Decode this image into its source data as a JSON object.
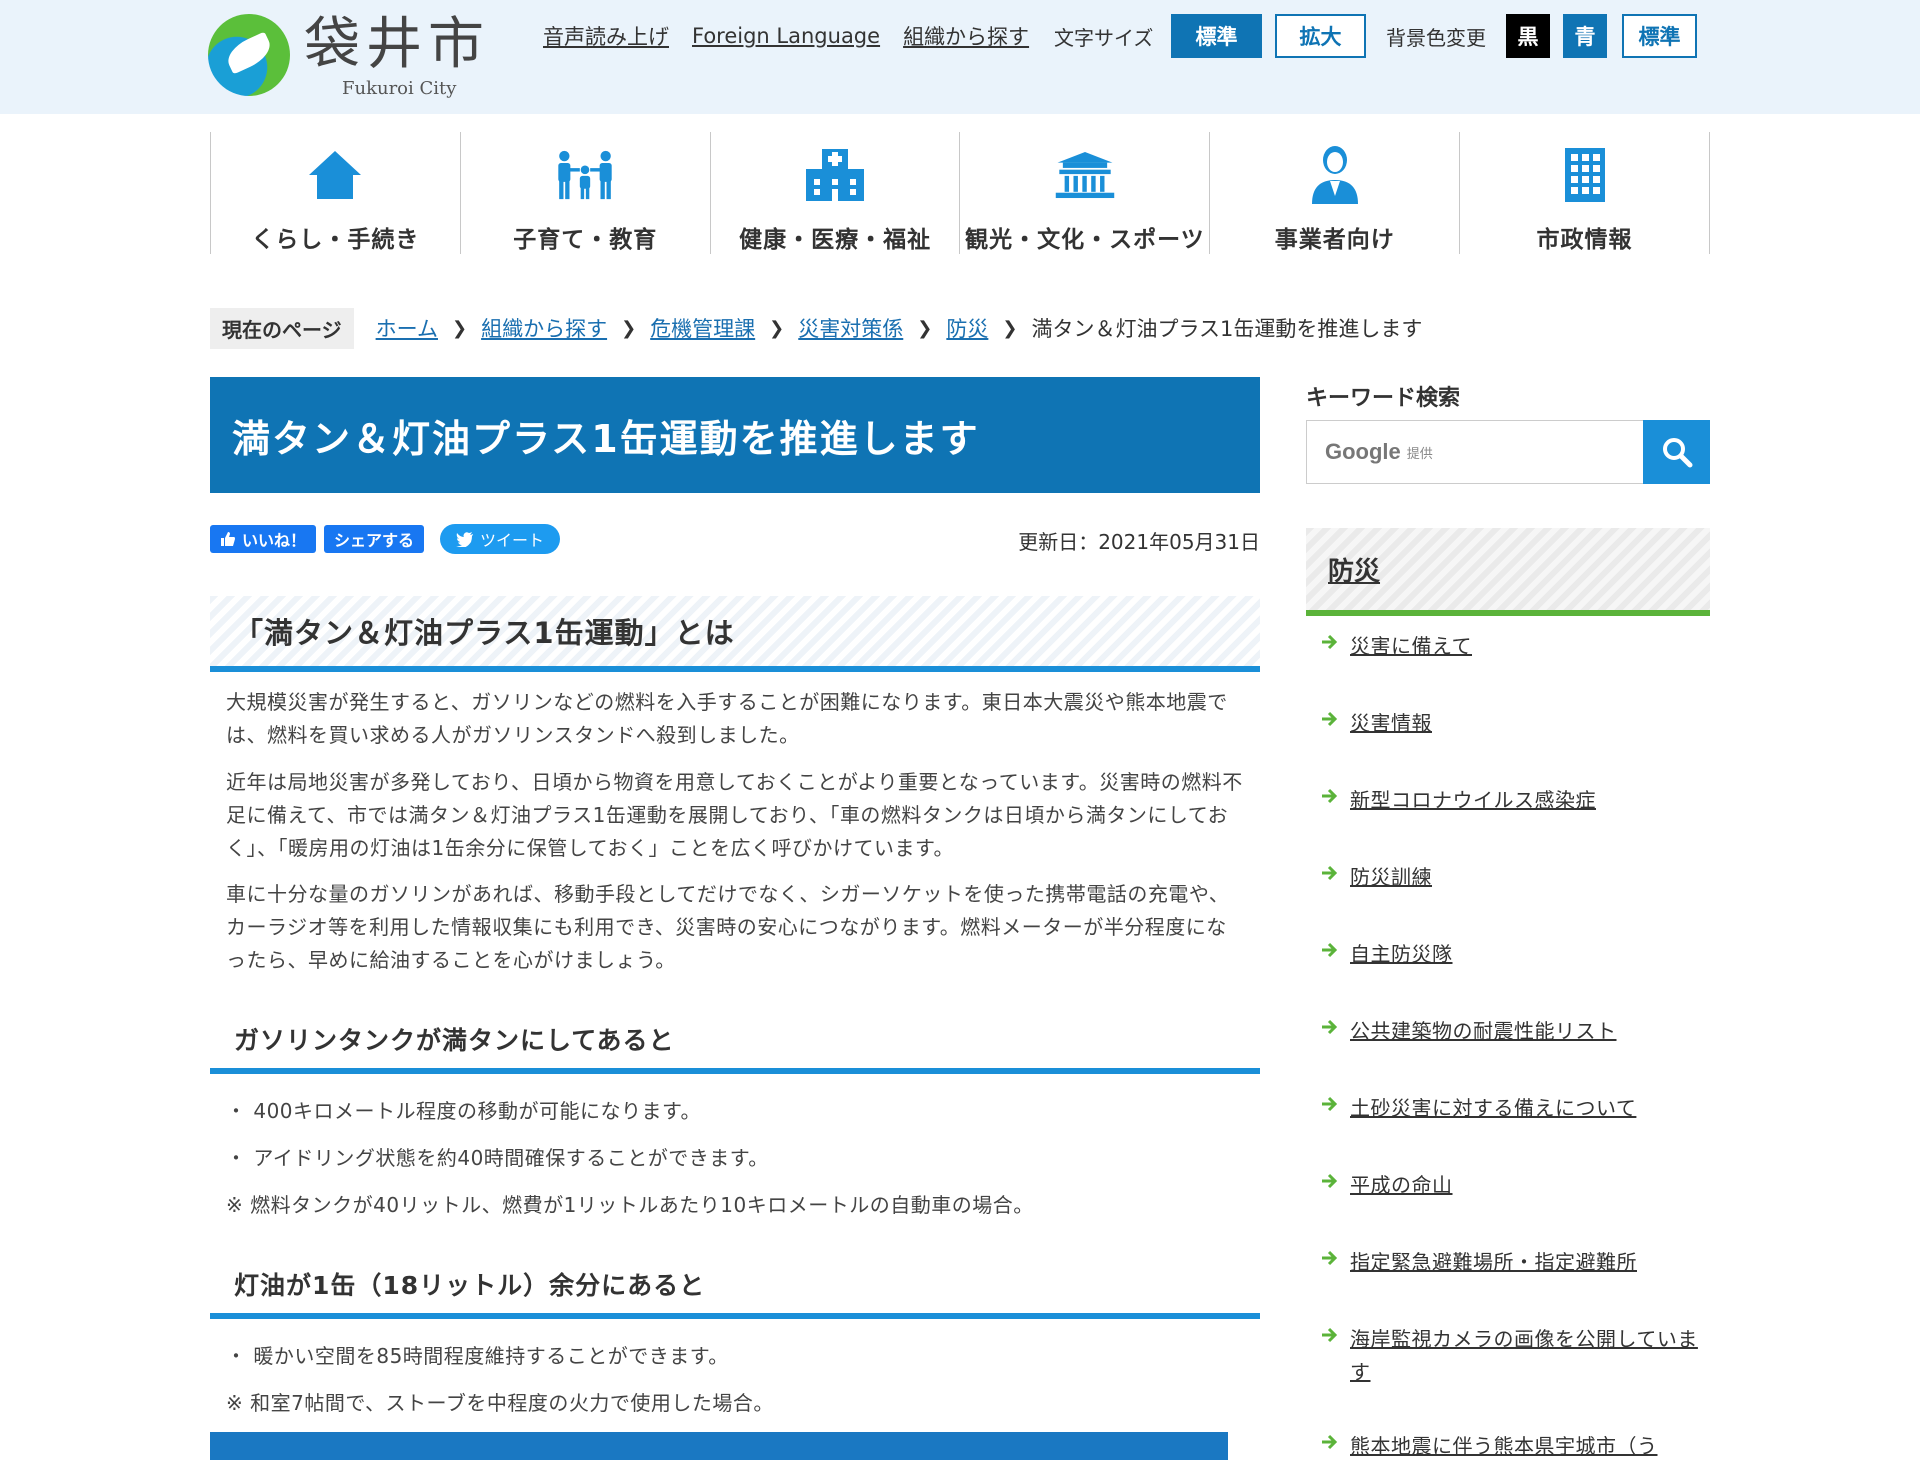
{
  "header": {
    "logo_title": "袋井市",
    "logo_sub": "Fukuroi City",
    "util_links": [
      "音声読み上げ",
      "Foreign Language",
      "組織から探す"
    ],
    "font_size_label": "文字サイズ",
    "font_size_standard": "標準",
    "font_size_large": "拡大",
    "bg_color_label": "背景色変更",
    "bg_black": "黒",
    "bg_blue": "青",
    "bg_standard": "標準"
  },
  "nav": [
    {
      "label": "くらし・手続き",
      "icon": "home-icon"
    },
    {
      "label": "子育て・教育",
      "icon": "family-icon"
    },
    {
      "label": "健康・医療・福祉",
      "icon": "hospital-icon"
    },
    {
      "label": "観光・文化・スポーツ",
      "icon": "temple-icon"
    },
    {
      "label": "事業者向け",
      "icon": "businessperson-icon"
    },
    {
      "label": "市政情報",
      "icon": "building-icon"
    }
  ],
  "breadcrumb": {
    "here_label": "現在のページ",
    "links": [
      "ホーム",
      "組織から探す",
      "危機管理課",
      "災害対策係",
      "防災"
    ],
    "current": "満タン＆灯油プラス1缶運動を推進します"
  },
  "main": {
    "title": "満タン＆灯油プラス1缶運動を推進します",
    "social": {
      "like": "いいね！",
      "share": "シェアする",
      "tweet": "ツイート"
    },
    "updated": "更新日：2021年05月31日",
    "section1_heading": "「満タン＆灯油プラス1缶運動」とは",
    "paragraphs": [
      "大規模災害が発生すると、ガソリンなどの燃料を入手することが困難になります。東日本大震災や熊本地震では、燃料を買い求める人がガソリンスタンドへ殺到しました。",
      "近年は局地災害が多発しており、日頃から物資を用意しておくことがより重要となっています。災害時の燃料不足に備えて、市では満タン＆灯油プラス1缶運動を展開しており、「車の燃料タンクは日頃から満タンにしておく」、「暖房用の灯油は1缶余分に保管しておく」ことを広く呼びかけています。",
      "車に十分な量のガソリンがあれば、移動手段としてだけでなく、シガーソケットを使った携帯電話の充電や、カーラジオ等を利用した情報収集にも利用でき、災害時の安心につながります。燃料メーターが半分程度になったら、早めに給油することを心がけましょう。"
    ],
    "section2_heading": "ガソリンタンクが満タンにしてあると",
    "section2_items": [
      "・ 400キロメートル程度の移動が可能になります。",
      "・ アイドリング状態を約40時間確保することができます。",
      "※ 燃料タンクが40リットル、燃費が1リットルあたり10キロメートルの自動車の場合。"
    ],
    "section3_heading": "灯油が1缶（18リットル）余分にあると",
    "section3_items": [
      "・ 暖かい空間を85時間程度維持することができます。",
      "※ 和室7帖間で、ストーブを中程度の火力で使用した場合。"
    ]
  },
  "sidebar": {
    "keyword_label": "キーワード検索",
    "search_brand": "Google",
    "search_brand_sub": "提供",
    "category_title": "防災",
    "links": [
      "災害に備えて",
      "災害情報",
      "新型コロナウイルス感染症",
      "防災訓練",
      "自主防災隊",
      "公共建築物の耐震性能リスト",
      "土砂災害に対する備えについて",
      "平成の命山",
      "指定緊急避難場所・指定避難所",
      "海岸監視カメラの画像を公開しています",
      "熊本地震に伴う熊本県宇城市（う"
    ]
  },
  "colors": {
    "primary_blue": "#0f74b4",
    "accent_blue": "#1a8fd8",
    "accent_green": "#5bb33a",
    "header_bg": "#eaf3fb"
  }
}
